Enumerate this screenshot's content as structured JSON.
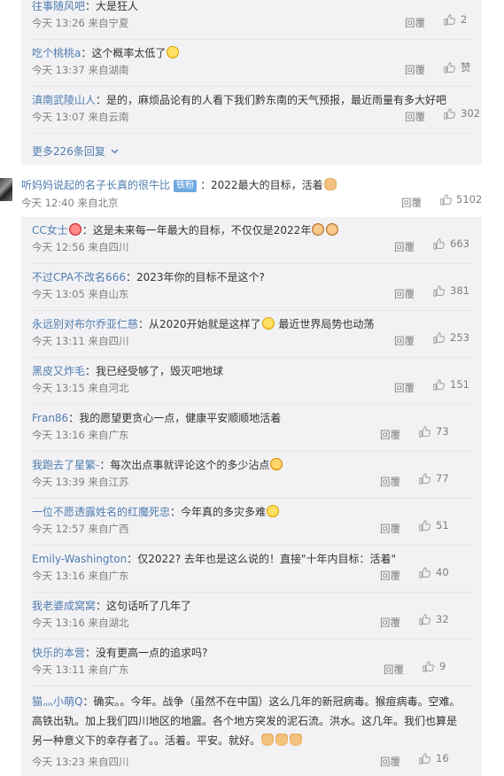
{
  "top_replies": [
    {
      "user": "往事随风吧",
      "text": "大是狂人",
      "time": "今天 13:26",
      "loc": "来自宁夏",
      "likes": "2"
    },
    {
      "user": "吃个桃桃a",
      "text": "这个概率太低了",
      "time": "今天 13:37",
      "loc": "来自湖南",
      "likes": "赞"
    },
    {
      "user": "滇南武陵山人",
      "text": "是的，麻烦品论有的人看下我们黔东南的天气预报，最近雨量有多大好吧",
      "time": "今天 13:07",
      "loc": "来自云南",
      "likes": "302"
    }
  ],
  "more_replies": "更多226条回复",
  "reply_label": "回覆",
  "main_comment": {
    "user": "听妈妈说起的名子长真的很牛比",
    "badge": "铁粉",
    "text": "2022最大的目标，活着",
    "time": "今天 12:40",
    "loc": "来自北京",
    "likes": "5102"
  },
  "sub_replies": [
    {
      "user": "CC女士",
      "text": "这是未来每一年最大的目标，不仅仅是2022年",
      "time": "今天 12:56",
      "loc": "来自四川",
      "likes": "663",
      "emoji": [
        "heart",
        "cat",
        "cat"
      ]
    },
    {
      "user": "不过CPA不改名666",
      "text": "2023年你的目标不是这个?",
      "time": "今天 13:05",
      "loc": "来自山东",
      "likes": "381"
    },
    {
      "user": "永远别对布尔乔亚仁慈",
      "text": "从2020开始就是这样了",
      "text2": "最近世界局势也动荡",
      "time": "今天 13:11",
      "loc": "来自四川",
      "likes": "253"
    },
    {
      "user": "黑皮又炸毛",
      "text": "我已经受够了，毁灭吧地球",
      "time": "今天 13:15",
      "loc": "来自河北",
      "likes": "151"
    },
    {
      "user": "Fran86",
      "text": "我的愿望更贪心一点，健康平安顺顺地活着",
      "time": "今天 13:16",
      "loc": "来自广东",
      "likes": "73"
    },
    {
      "user": "我跑去了星繁-",
      "text": "每次出点事就评论这个的多少沾点",
      "time": "今天 13:39",
      "loc": "来自江苏",
      "likes": "77"
    },
    {
      "user": "一位不愿透露姓名的红魔死忠",
      "text": "今年真的多灾多难",
      "time": "今天 12:57",
      "loc": "来自广西",
      "likes": "51"
    },
    {
      "user": "Emily-Washington",
      "text": "仅2022? 去年也是这么说的！直接\"十年内目标：活着\"",
      "time": "今天 13:16",
      "loc": "来自广东",
      "likes": "40"
    },
    {
      "user": "我老婆成窝窝",
      "text": "这句话听了几年了",
      "time": "今天 13:16",
      "loc": "来自湖北",
      "likes": "32"
    },
    {
      "user": "快乐的本营",
      "text": "没有更高一点的追求吗?",
      "time": "今天 13:11",
      "loc": "来自广东",
      "likes": "9"
    },
    {
      "user": "猫灬小萌Q",
      "text": "确实。。今年。战争（虽然不在中国）这么几年的新冠病毒。猴痘病毒。空难。高铁出轨。加上我们四川地区的地震。各个地方突发的泥石流。洪水。这几年。我们也算是另一种意义下的幸存者了。。活着。平安。就好。",
      "time": "今天 13:23",
      "loc": "来自四川",
      "likes": "16"
    }
  ]
}
